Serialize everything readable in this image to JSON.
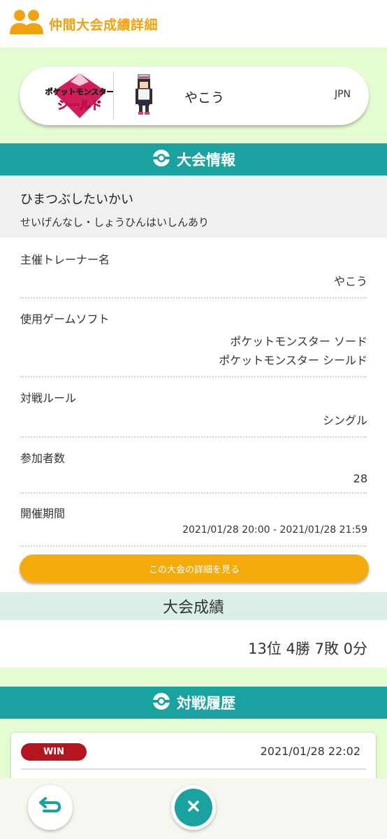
{
  "header": {
    "title": "仲間大会成績詳細",
    "icon": "friends-icon"
  },
  "profile": {
    "logo_line1": "ポケットモンスター",
    "logo_line2": "シールド",
    "name": "やこう",
    "region": "JPN"
  },
  "tournament_info": {
    "heading": "大会情報",
    "name": "ひまつぶしたいかい",
    "rule": "せいげんなし・しょうひんはいしんあり",
    "rows": [
      {
        "label": "主催トレーナー名",
        "value": "やこう"
      },
      {
        "label": "使用ゲームソフト",
        "value1": "ポケットモンスター ソード",
        "value2": "ポケットモンスター シールド"
      },
      {
        "label": "対戦ルール",
        "value": "シングル"
      },
      {
        "label": "参加者数",
        "value": "28"
      },
      {
        "label": "開催期間",
        "value": "2021/01/28 20:00 - 2021/01/28 21:59"
      }
    ],
    "details_button": "この大会の詳細を見る"
  },
  "results": {
    "heading": "大会成績",
    "value": "13位 4勝 7敗 0分"
  },
  "history": {
    "heading": "対戦履歴",
    "items": [
      {
        "result": "WIN",
        "datetime": "2021/01/28 22:02"
      }
    ]
  },
  "colors": {
    "accent_orange": "#f6ab0c",
    "teal": "#19a29f",
    "light_green": "#e5fbd1",
    "win_red": "#b3161f"
  }
}
